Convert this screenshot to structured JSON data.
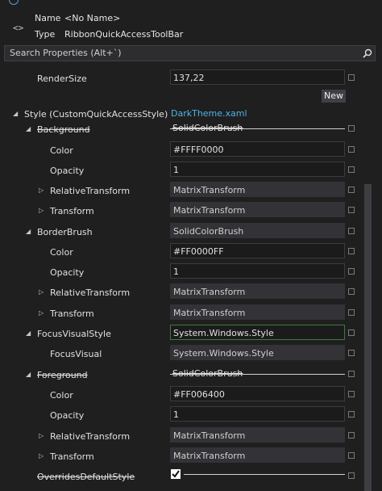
{
  "header": {
    "name_label": "Name",
    "name_value": "<No Name>",
    "type_label": "Type",
    "type_value": "RibbonQuickAccessToolBar"
  },
  "search": {
    "placeholder": "Search Properties (Alt+`)"
  },
  "new_button": "New",
  "properties": [
    {
      "label": "RenderSize",
      "value": "137,22",
      "kind": "input"
    },
    {
      "label": "Style (CustomQuickAccessStyle)",
      "value": "DarkTheme.xaml",
      "kind": "link",
      "expander": "expanded"
    },
    {
      "label": "Background",
      "value": "SolidColorBrush",
      "kind": "strike",
      "expander": "expanded",
      "strike": true
    },
    {
      "label": "Color",
      "value": "#FFFF0000",
      "kind": "input"
    },
    {
      "label": "Opacity",
      "value": "1",
      "kind": "input"
    },
    {
      "label": "RelativeTransform",
      "value": "MatrixTransform",
      "kind": "readonly",
      "expander": "collapsed"
    },
    {
      "label": "Transform",
      "value": "MatrixTransform",
      "kind": "readonly",
      "expander": "collapsed"
    },
    {
      "label": "BorderBrush",
      "value": "SolidColorBrush",
      "kind": "readonly",
      "expander": "expanded"
    },
    {
      "label": "Color",
      "value": "#FF0000FF",
      "kind": "input"
    },
    {
      "label": "Opacity",
      "value": "1",
      "kind": "input"
    },
    {
      "label": "RelativeTransform",
      "value": "MatrixTransform",
      "kind": "readonly",
      "expander": "collapsed"
    },
    {
      "label": "Transform",
      "value": "MatrixTransform",
      "kind": "readonly",
      "expander": "collapsed"
    },
    {
      "label": "FocusVisualStyle",
      "value": "System.Windows.Style",
      "kind": "green",
      "expander": "expanded"
    },
    {
      "label": "FocusVisual",
      "value": "System.Windows.Style",
      "kind": "readonly"
    },
    {
      "label": "Foreground",
      "value": "SolidColorBrush",
      "kind": "strike",
      "expander": "expanded",
      "strike": true
    },
    {
      "label": "Color",
      "value": "#FF006400",
      "kind": "input"
    },
    {
      "label": "Opacity",
      "value": "1",
      "kind": "input"
    },
    {
      "label": "RelativeTransform",
      "value": "MatrixTransform",
      "kind": "readonly",
      "expander": "collapsed"
    },
    {
      "label": "Transform",
      "value": "MatrixTransform",
      "kind": "readonly",
      "expander": "collapsed"
    },
    {
      "label": "OverridesDefaultStyle",
      "value": "true",
      "kind": "checkbox",
      "strike": true
    }
  ],
  "icons": {
    "element": "code-brackets-icon",
    "search": "search-icon",
    "expanded": "triangle-down-icon",
    "collapsed": "triangle-right-icon"
  },
  "colors": {
    "link": "#4fb3e8",
    "background": "#1f1f1f",
    "green_border": "#3c7a3c"
  }
}
